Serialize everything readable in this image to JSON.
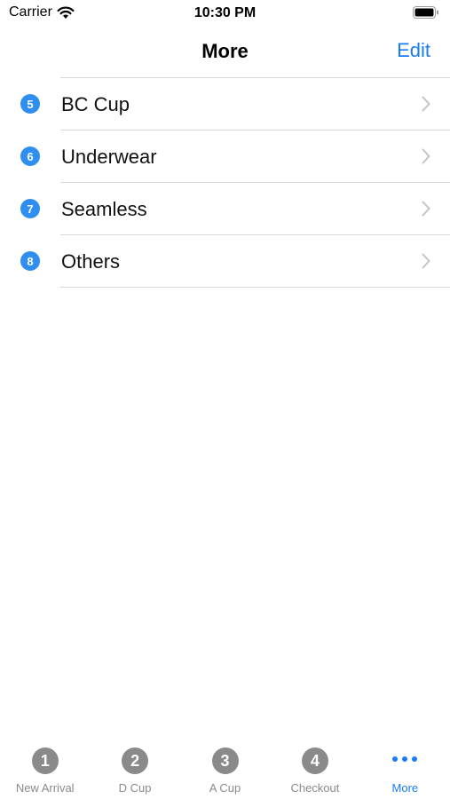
{
  "status_bar": {
    "carrier": "Carrier",
    "time": "10:30 PM"
  },
  "nav": {
    "title": "More",
    "edit_label": "Edit"
  },
  "list": [
    {
      "badge": "5",
      "label": "BC Cup"
    },
    {
      "badge": "6",
      "label": "Underwear"
    },
    {
      "badge": "7",
      "label": "Seamless"
    },
    {
      "badge": "8",
      "label": "Others"
    }
  ],
  "tabs": [
    {
      "icon_text": "1",
      "label": "New Arrival"
    },
    {
      "icon_text": "2",
      "label": "D Cup"
    },
    {
      "icon_text": "3",
      "label": "A Cup"
    },
    {
      "icon_text": "4",
      "label": "Checkout"
    },
    {
      "icon": "ellipsis-icon",
      "label": "More",
      "active": true
    }
  ],
  "colors": {
    "accent": "#1a7cf5",
    "badge": "#2f8ff0",
    "inactive_tab": "#8a8a8a",
    "separator": "#d8d8d8"
  }
}
